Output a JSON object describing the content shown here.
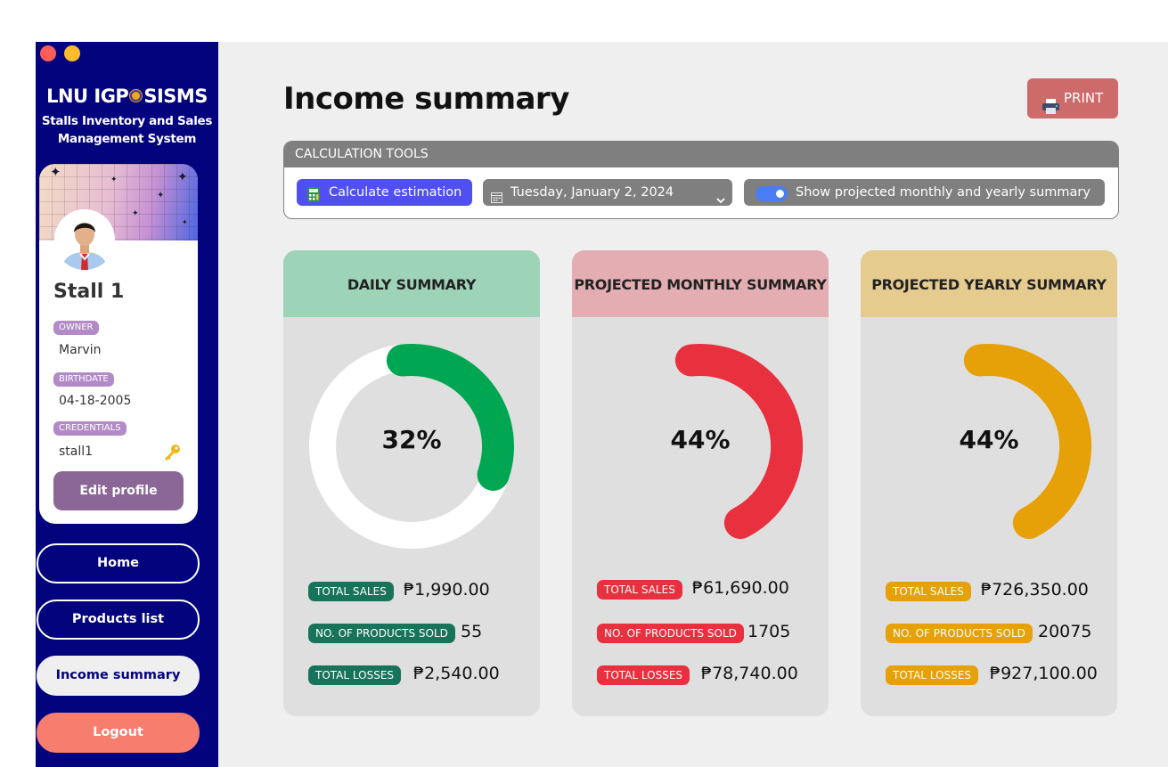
{
  "window": {
    "dots": [
      "#fc5d57",
      "#fdbc2e"
    ]
  },
  "sidebar": {
    "brand_left": "LNU IGP",
    "brand_right": "SISMS",
    "subtitle_line1": "Stalls Inventory and Sales",
    "subtitle_line2": "Management System",
    "profile": {
      "stall_name": "Stall 1",
      "owner_label": "OWNER",
      "owner": "Marvin",
      "birthdate_label": "BIRTHDATE",
      "birthdate": "04-18-2005",
      "credentials_label": "CREDENTIALS",
      "credentials": "stall1",
      "edit_label": "Edit profile"
    },
    "nav": {
      "home": "Home",
      "products": "Products list",
      "income": "Income summary",
      "logout": "Logout"
    }
  },
  "main": {
    "title": "Income summary",
    "print_label": "PRINT",
    "tools": {
      "header": "CALCULATION TOOLS",
      "calc_label": "Calculate estimation",
      "date_value": "Tuesday, January 2, 2024",
      "toggle_label": "Show projected monthly and yearly summary",
      "toggle_on": true
    },
    "cards": {
      "daily": {
        "title": "DAILY SUMMARY",
        "percent_label": "32%",
        "percent": 32,
        "color": "#00a651",
        "header_color": "#9dd4b8",
        "tag_color": "#17745a",
        "total_sales_label": "TOTAL SALES",
        "total_sales": "₱1,990.00",
        "products_sold_label": "NO. OF PRODUCTS SOLD",
        "products_sold": "55",
        "total_losses_label": "TOTAL LOSSES",
        "total_losses": "₱2,540.00"
      },
      "monthly": {
        "title": "PROJECTED MONTHLY SUMMARY",
        "percent_label": "44%",
        "percent": 44,
        "color": "#e8303f",
        "header_color": "#e4adb1",
        "tag_color": "#e8303f",
        "total_sales_label": "TOTAL SALES",
        "total_sales": "₱61,690.00",
        "products_sold_label": "NO. OF PRODUCTS SOLD",
        "products_sold": "1705",
        "total_losses_label": "TOTAL LOSSES",
        "total_losses": "₱78,740.00"
      },
      "yearly": {
        "title": "PROJECTED YEARLY SUMMARY",
        "percent_label": "44%",
        "percent": 44,
        "color": "#e6a008",
        "header_color": "#e6cb8e",
        "tag_color": "#e6a008",
        "total_sales_label": "TOTAL SALES",
        "total_sales": "₱726,350.00",
        "products_sold_label": "NO. OF PRODUCTS SOLD",
        "products_sold": "20075",
        "total_losses_label": "TOTAL LOSSES",
        "total_losses": "₱927,100.00"
      }
    }
  }
}
